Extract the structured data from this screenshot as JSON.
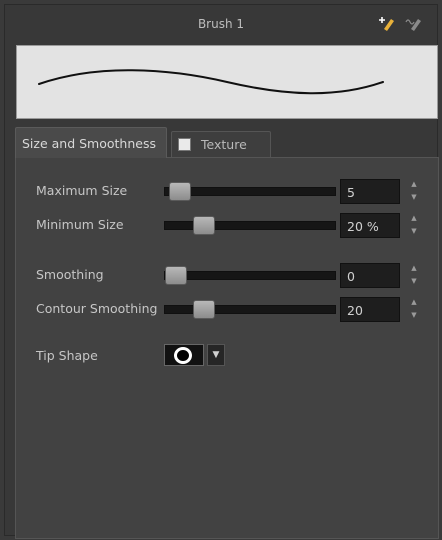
{
  "header": {
    "title": "Brush 1",
    "icons": [
      "new-brush-icon",
      "brush-options-icon"
    ]
  },
  "tabs": [
    {
      "label": "Size and Smoothness",
      "active": true
    },
    {
      "label": "Texture",
      "active": false,
      "checkbox_checked": false
    }
  ],
  "settings": [
    {
      "label": "Maximum Size",
      "value": "5",
      "level": 0.05
    },
    {
      "label": "Minimum Size",
      "value": "20 %",
      "level": 0.2
    },
    {
      "label": "Smoothing",
      "value": "0",
      "level": 0.0
    },
    {
      "label": "Contour Smoothing",
      "value": "20",
      "level": 0.2
    }
  ],
  "tip_shape": {
    "label": "Tip Shape",
    "selected": "round-tip-icon"
  },
  "colors": {
    "panel_bg": "#383838",
    "content_bg": "#424242",
    "preview_bg": "#e3e3e3",
    "accent_icon": "#e8b13a"
  }
}
